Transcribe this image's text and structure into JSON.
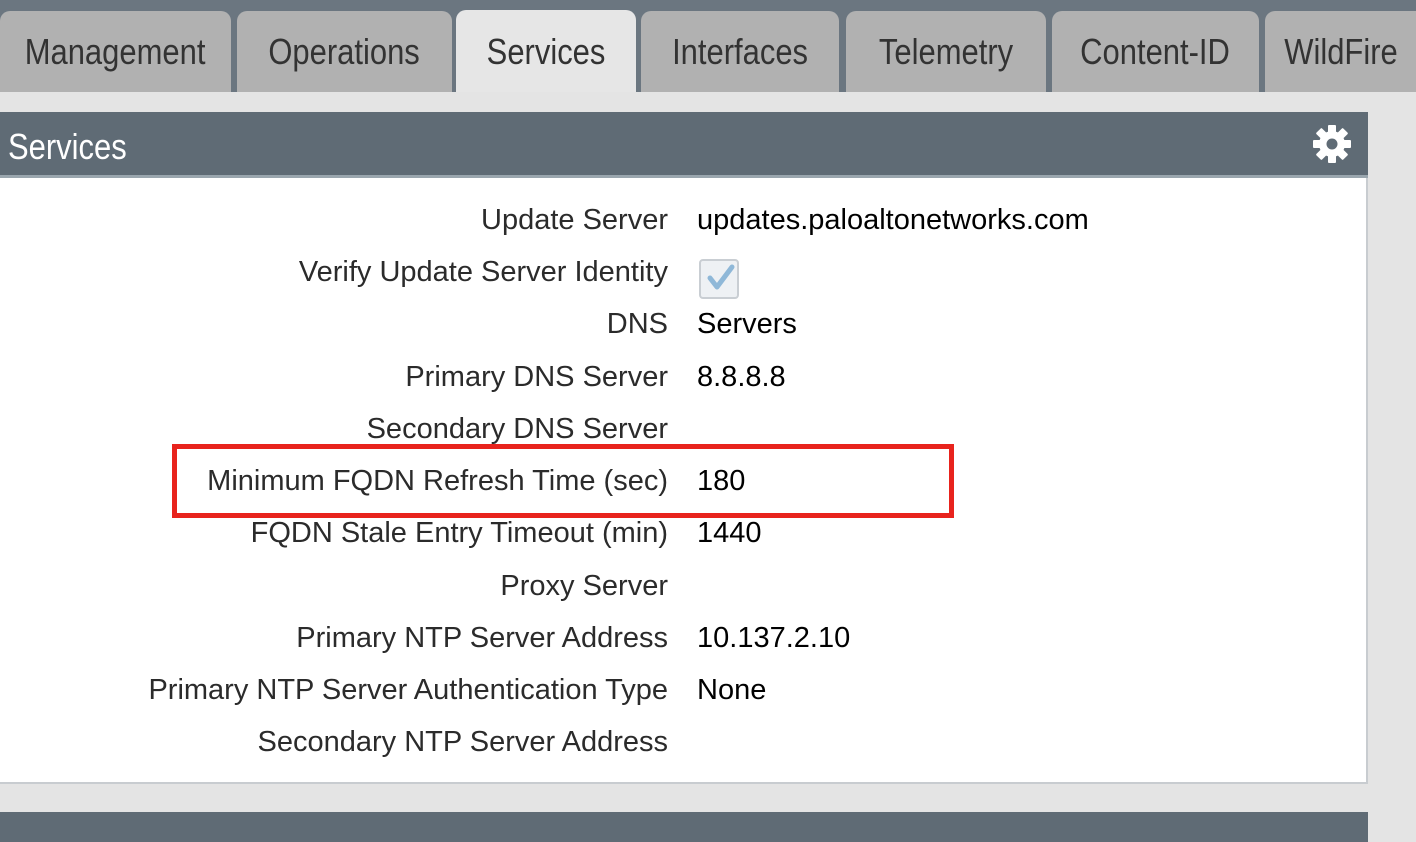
{
  "tabs": [
    {
      "label": "Management",
      "active": false
    },
    {
      "label": "Operations",
      "active": false
    },
    {
      "label": "Services",
      "active": true
    },
    {
      "label": "Interfaces",
      "active": false
    },
    {
      "label": "Telemetry",
      "active": false
    },
    {
      "label": "Content-ID",
      "active": false
    },
    {
      "label": "WildFire",
      "active": false
    }
  ],
  "panel": {
    "title": "Services",
    "gear_icon": "gear-icon",
    "rows": [
      {
        "label": "Update Server",
        "value": "updates.paloaltonetworks.com"
      },
      {
        "label": "Verify Update Server Identity",
        "checked": true
      },
      {
        "label": "DNS",
        "value": "Servers"
      },
      {
        "label": "Primary DNS Server",
        "value": "8.8.8.8"
      },
      {
        "label": "Secondary DNS Server",
        "value": ""
      },
      {
        "label": "Minimum FQDN Refresh Time (sec)",
        "value": "180"
      },
      {
        "label": "FQDN Stale Entry Timeout (min)",
        "value": "1440"
      },
      {
        "label": "Proxy Server",
        "value": ""
      },
      {
        "label": "Primary NTP Server Address",
        "value": "10.137.2.10"
      },
      {
        "label": "Primary NTP Server Authentication Type",
        "value": "None"
      },
      {
        "label": "Secondary NTP Server Address",
        "value": ""
      }
    ]
  },
  "colors": {
    "header_bg": "#5f6b75",
    "tab_bg": "#b1b1b1",
    "tab_active_bg": "#e6e6e6",
    "highlight": "#e8231d"
  }
}
